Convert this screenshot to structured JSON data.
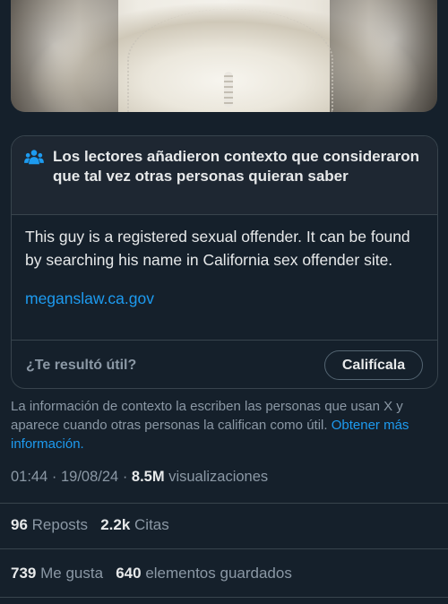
{
  "note": {
    "title": "Los lectores añadieron contexto que consideraron que tal vez otras personas quieran saber",
    "body": "This guy is a registered sexual offender. It can be found by searching his name in California sex offender site.",
    "link": "meganslaw.ca.gov",
    "helpful_question": "¿Te resultó útil?",
    "rate_button": "Califícala"
  },
  "disclaimer": {
    "text": "La información de contexto la escriben las personas que usan X y aparece cuando otras personas la califican como útil.",
    "link": "Obtener más información."
  },
  "post_meta": {
    "time": "01:44",
    "date": "19/08/24",
    "views_count": "8.5M",
    "views_label": "visualizaciones"
  },
  "stats": {
    "reposts_count": "96",
    "reposts_label": "Reposts",
    "quotes_count": "2.2k",
    "quotes_label": "Citas",
    "likes_count": "739",
    "likes_label": "Me gusta",
    "bookmarks_count": "640",
    "bookmarks_label": "elementos guardados"
  },
  "icons": {
    "note_header": "people-icon"
  },
  "colors": {
    "background": "#15202b",
    "accent": "#1d9bf0",
    "muted_text": "#8b98a5",
    "border": "#38444d"
  }
}
